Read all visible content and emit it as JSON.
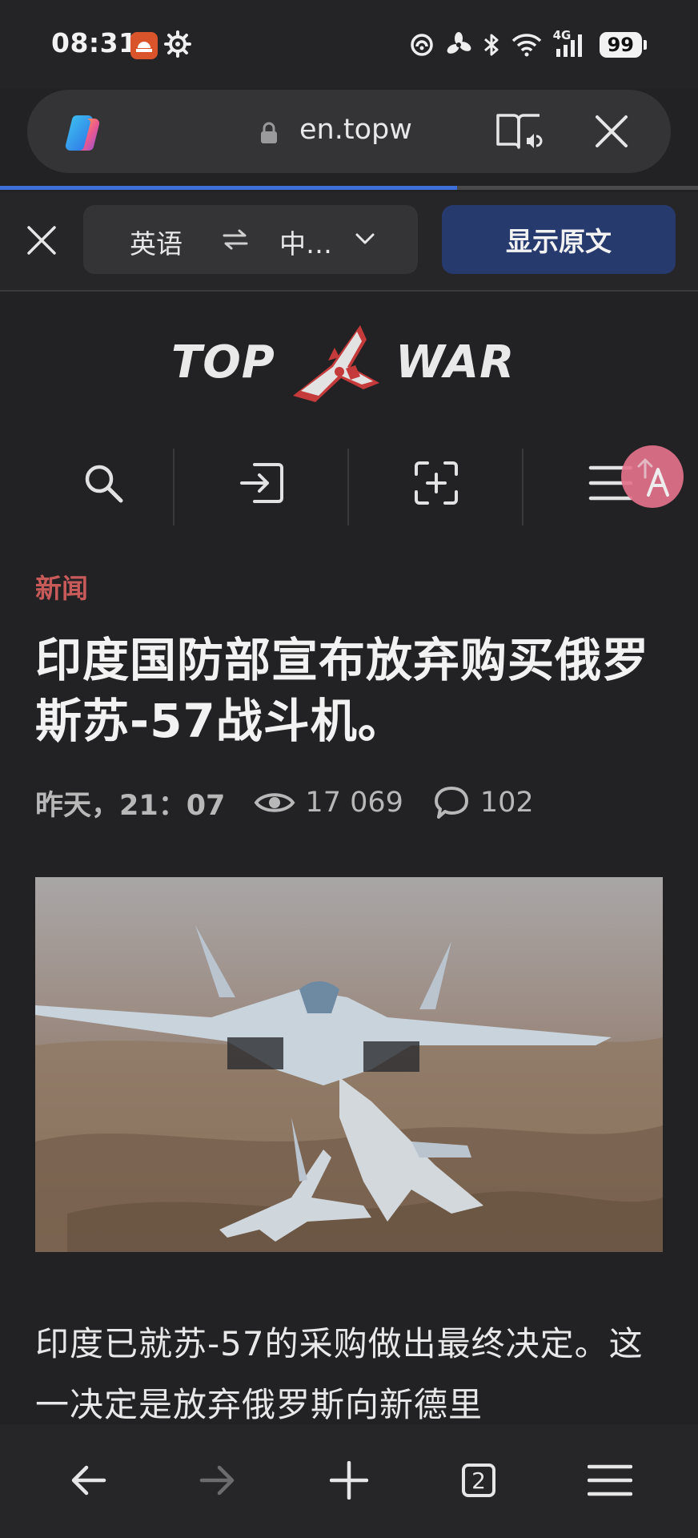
{
  "status_bar": {
    "time": "08:31",
    "network_label": "4G",
    "battery": "99",
    "app_icon": "notification-app-icon",
    "icons": [
      "gear-icon",
      "hotspot-icon",
      "fan-icon",
      "bluetooth-icon",
      "wifi-icon",
      "signal-icon"
    ]
  },
  "browser": {
    "url": "en.topw",
    "progress": 0.655,
    "accent_color": "#3d6fd8",
    "icons": [
      "copilot-icon",
      "lock-icon",
      "reader-icon",
      "close-tab-icon"
    ]
  },
  "translation_bar": {
    "source_lang": "英语",
    "target_lang": "中…",
    "show_original_label": "显示原文",
    "button_color": "#273a6e"
  },
  "site": {
    "logo_left": "TOP",
    "logo_right": "WAR",
    "nav_icons": [
      "search-icon",
      "login-icon",
      "add-icon",
      "menu-icon"
    ]
  },
  "article": {
    "tag": "新闻",
    "tag_color": "#c95a5a",
    "title": "印度国防部宣布放弃购买俄罗斯苏-57战斗机。",
    "date": "昨天，21：07",
    "views": "17 069",
    "comments": "102",
    "body": "印度已就苏-57的采购做出最终决定。这一决定是放弃俄罗斯向新德里"
  },
  "bottom_bar": {
    "tabs_count": "2",
    "icons": [
      "back-icon",
      "forward-icon",
      "new-tab-icon",
      "tabs-icon",
      "menu-icon"
    ]
  }
}
